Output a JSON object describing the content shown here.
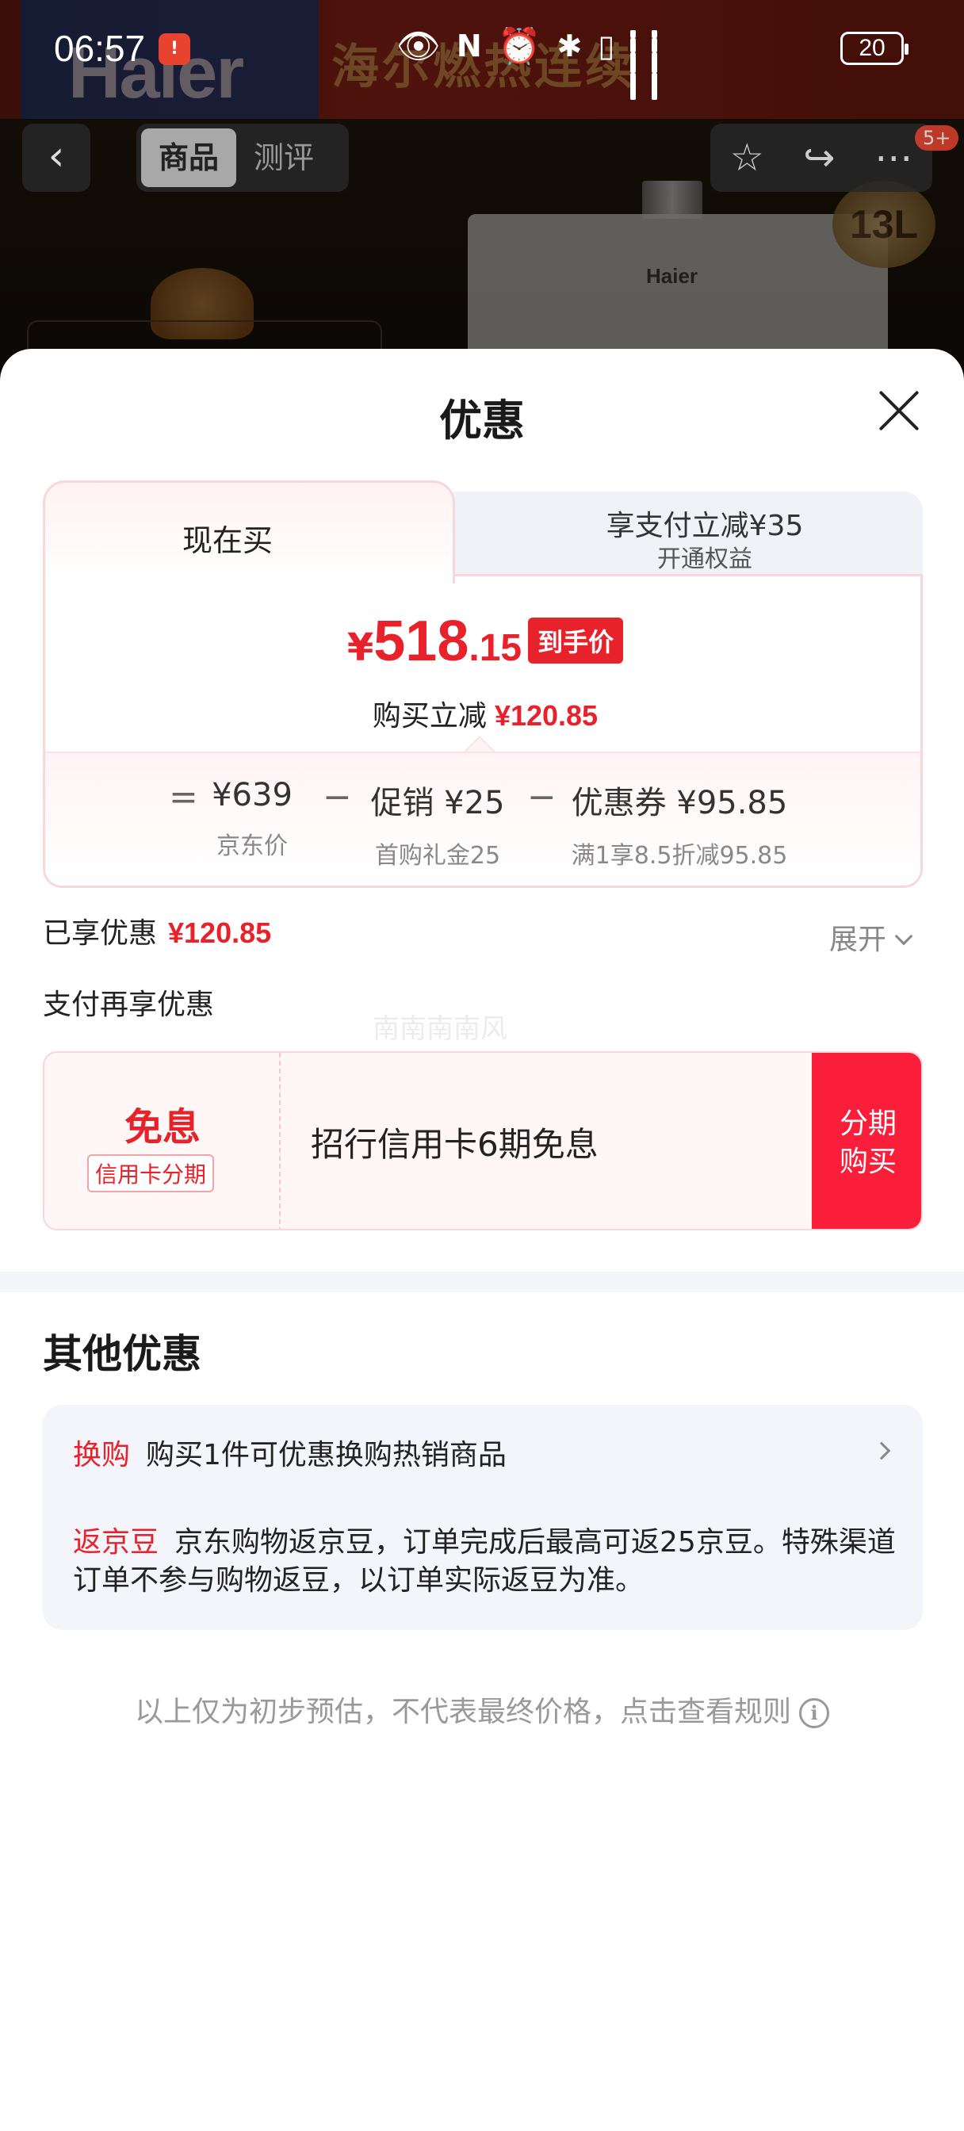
{
  "status_bar": {
    "time": "06:57",
    "battery": "20",
    "icons": [
      "notification-icon",
      "eye-icon",
      "nfc-icon",
      "alarm-icon",
      "bluetooth-icon",
      "vibrate-icon",
      "signal-icon",
      "signal-icon"
    ]
  },
  "background": {
    "logo": "Haier",
    "slogan": "海尔燃热连续",
    "product_brand": "Haier",
    "capacity_badge": "13L"
  },
  "nav": {
    "tabs": [
      {
        "label": "商品",
        "active": true
      },
      {
        "label": "测评",
        "active": false
      }
    ],
    "more_badge": "5+"
  },
  "sheet": {
    "title": "优惠",
    "tabs": {
      "now": "现在买",
      "pay_title": "享支付立减¥35",
      "pay_sub": "开通权益"
    },
    "price": {
      "yen": "¥",
      "integer": "518",
      "decimal": ".15",
      "tag": "到手价",
      "sub_label": "购买立减",
      "sub_amount": "¥120.85"
    },
    "breakdown": {
      "eq": "=",
      "minus": "−",
      "items": [
        {
          "value": "¥639",
          "label": "京东价"
        },
        {
          "value": "促销 ¥25",
          "label": "首购礼金25"
        },
        {
          "value": "优惠券 ¥95.85",
          "label": "满1享8.5折减95.85"
        }
      ]
    },
    "enjoyed_label": "已享优惠",
    "enjoyed_amount": "¥120.85",
    "expand": "展开",
    "pay_more": "支付再享优惠",
    "watermark": "南南南南风",
    "installment": {
      "free": "免息",
      "tag": "信用卡分期",
      "text": "招行信用卡6期免息",
      "button_line1": "分期",
      "button_line2": "购买"
    },
    "other": {
      "title": "其他优惠",
      "row1_label": "换购",
      "row1_text": "购买1件可优惠换购热销商品",
      "row2_label": "返京豆",
      "row2_text": "京东购物返京豆，订单完成后最高可返25京豆。特殊渠道订单不参与购物返豆，以订单实际返豆为准。"
    },
    "disclaimer": "以上仅为初步预估，不代表最终价格，点击查看规则",
    "info_glyph": "i"
  },
  "colors": {
    "accent_red": "#e8222b",
    "button_red": "#fa1e3a",
    "pink_border": "#f8d7da"
  }
}
